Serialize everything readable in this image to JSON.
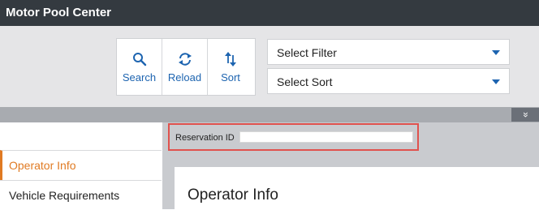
{
  "app": {
    "title": "Motor Pool Center"
  },
  "toolbar": {
    "buttons": [
      {
        "label": "Search",
        "icon": "search-icon"
      },
      {
        "label": "Reload",
        "icon": "reload-icon"
      },
      {
        "label": "Sort",
        "icon": "sort-icon"
      }
    ],
    "filter_select": {
      "value": "Select Filter"
    },
    "sort_select": {
      "value": "Select Sort"
    },
    "collapse_icon": "»"
  },
  "sidebar": {
    "items": [
      {
        "label": "Operator Info",
        "active": true
      },
      {
        "label": "Vehicle Requirements",
        "active": false
      }
    ]
  },
  "reservation": {
    "label": "Reservation ID",
    "value": ""
  },
  "main": {
    "heading": "Operator Info"
  },
  "colors": {
    "accent": "#e07a22",
    "primary_blue": "#1d64b0",
    "titlebar": "#343a40",
    "highlight_border": "#e0524e"
  }
}
